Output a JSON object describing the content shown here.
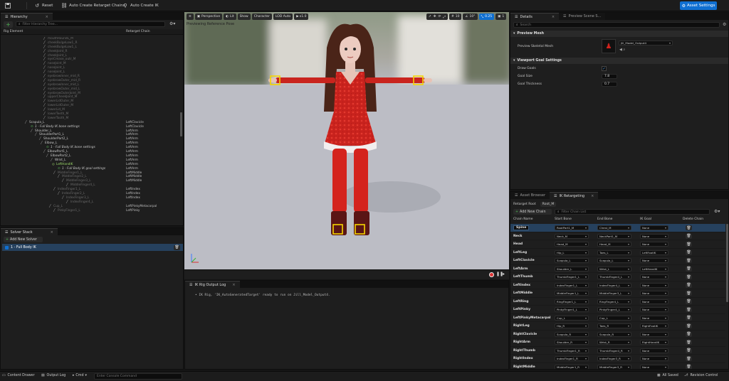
{
  "toolbar": {
    "save_icon": "save-icon",
    "reset": "Reset",
    "auto_create_chains": "Auto Create Retarget Chains",
    "auto_create_ik": "Auto Create IK",
    "asset_settings": "Asset Settings"
  },
  "hierarchy": {
    "tab": "Hierarchy",
    "filter_placeholder": "Filter Hierarchy Tree...",
    "col_element": "Rig Element",
    "col_chain": "Retarget Chain",
    "rows": [
      {
        "name": "mouthRoundL_M",
        "chain": "",
        "indent": 66,
        "dim": true
      },
      {
        "name": "cheekBulgeLow1_R",
        "chain": "",
        "indent": 66,
        "dim": true
      },
      {
        "name": "cheekBulgeLow1_L",
        "chain": "",
        "indent": 66,
        "dim": true
      },
      {
        "name": "cheekJoint_R",
        "chain": "",
        "indent": 66,
        "dim": true
      },
      {
        "name": "cheekJoint_L",
        "chain": "",
        "indent": 66,
        "dim": true
      },
      {
        "name": "eyeCrease_outr_M",
        "chain": "",
        "indent": 66,
        "dim": true
      },
      {
        "name": "noseJoint_M",
        "chain": "",
        "indent": 66,
        "dim": true
      },
      {
        "name": "noseJoint_L",
        "chain": "",
        "indent": 66,
        "dim": true
      },
      {
        "name": "noseJoint_L",
        "chain": "",
        "indent": 66,
        "dim": true
      },
      {
        "name": "eyebrowInner_mid_R",
        "chain": "",
        "indent": 66,
        "dim": true
      },
      {
        "name": "eyebrowOuter_mid_R",
        "chain": "",
        "indent": 66,
        "dim": true
      },
      {
        "name": "eyebrowInner_mid_L",
        "chain": "",
        "indent": 66,
        "dim": true
      },
      {
        "name": "eyebrowOuter_mid_L",
        "chain": "",
        "indent": 66,
        "dim": true
      },
      {
        "name": "eyebrowOuterJoint_M",
        "chain": "",
        "indent": 66,
        "dim": true
      },
      {
        "name": "upperCheekJoint_M",
        "chain": "",
        "indent": 66,
        "dim": true
      },
      {
        "name": "lowerLidOuter_M",
        "chain": "",
        "indent": 66,
        "dim": true
      },
      {
        "name": "lowerLidOuter_M",
        "chain": "",
        "indent": 66,
        "dim": true
      },
      {
        "name": "lowerLid_M",
        "chain": "",
        "indent": 66,
        "dim": true
      },
      {
        "name": "lowerTeeth_M",
        "chain": "",
        "indent": 66,
        "dim": true
      },
      {
        "name": "lowerTooth_M",
        "chain": "",
        "indent": 66,
        "dim": true
      },
      {
        "name": "Scapula_L",
        "chain": "LeftClavicle",
        "indent": 40,
        "dim": false
      },
      {
        "name": "1 - Full Body IK bone settings",
        "chain": "LeftClavicle",
        "indent": 48,
        "dim": false,
        "italic": true
      },
      {
        "name": "Shoulder_L",
        "chain": "LeftArm",
        "indent": 48,
        "dim": false
      },
      {
        "name": "ShoulderPart1_L",
        "chain": "LeftArm",
        "indent": 54,
        "dim": false
      },
      {
        "name": "ShoulderPart2_L",
        "chain": "LeftArm",
        "indent": 60,
        "dim": false
      },
      {
        "name": "Elbow_L",
        "chain": "LeftArm",
        "indent": 62,
        "dim": false
      },
      {
        "name": "1 - Full Body IK bone settings",
        "chain": "LeftArm",
        "indent": 70,
        "dim": false,
        "italic": true
      },
      {
        "name": "ElbowPart1_L",
        "chain": "LeftArm",
        "indent": 66,
        "dim": false
      },
      {
        "name": "ElbowPart2_L",
        "chain": "LeftArm",
        "indent": 70,
        "dim": false
      },
      {
        "name": "Wrist_L",
        "chain": "LeftArm",
        "indent": 76,
        "dim": false
      },
      {
        "name": "LeftHandIK",
        "chain": "LeftArm",
        "indent": 78,
        "dim": false,
        "goal": true
      },
      {
        "name": "1 - Full Body IK goal settings",
        "chain": "LeftArm",
        "indent": 86,
        "dim": false,
        "italic": true
      },
      {
        "name": "MiddleFinger1_L",
        "chain": "LeftMiddle",
        "indent": 80,
        "dim": true
      },
      {
        "name": "MiddleFinger2_L",
        "chain": "LeftMiddle",
        "indent": 86,
        "dim": true
      },
      {
        "name": "MiddleFinger3_L",
        "chain": "LeftMiddle",
        "indent": 92,
        "dim": true
      },
      {
        "name": "MiddleFinger4_L",
        "chain": "",
        "indent": 98,
        "dim": true
      },
      {
        "name": "IndexFinger1_L",
        "chain": "LeftIndex",
        "indent": 80,
        "dim": true
      },
      {
        "name": "IndexFinger2_L",
        "chain": "LeftIndex",
        "indent": 86,
        "dim": true
      },
      {
        "name": "IndexFinger3_L",
        "chain": "LeftIndex",
        "indent": 92,
        "dim": true
      },
      {
        "name": "IndexFinger4_L",
        "chain": "",
        "indent": 98,
        "dim": true
      },
      {
        "name": "Cup_L",
        "chain": "LeftPinkyMetacarpal",
        "indent": 74,
        "dim": true
      },
      {
        "name": "PinkyFinger1_L",
        "chain": "LeftPinky",
        "indent": 80,
        "dim": true
      }
    ]
  },
  "solver": {
    "tab": "Solver Stack",
    "add_new": "Add New Solver",
    "item": "1 - Full Body IK"
  },
  "viewport": {
    "perspective": "Perspective",
    "lit": "Lit",
    "show": "Show",
    "character": "Character",
    "lod": "LOD Auto",
    "speed": "x1.0",
    "overlay": "Previewing Reference Pose",
    "grid": "10",
    "angle": "10°",
    "scale": "0.25",
    "cam": "1"
  },
  "output_log": {
    "tab": "IK Rig Output Log",
    "line": "• IK Rig, 'IK_AutoGeneratedTarget' ready to run on Jill_Model_Output4."
  },
  "details": {
    "tab": "Details",
    "tab2": "Preview Scene S...",
    "search_placeholder": "Search",
    "section_mesh": "Preview Mesh",
    "preview_mesh_label": "Preview Skeletal Mesh",
    "preview_mesh_value": "Jill_Model_Output4",
    "section_goal": "Viewport Goal Settings",
    "draw_goals_label": "Draw Goals",
    "goal_size_label": "Goal Size",
    "goal_size_value": "7.8",
    "goal_thickness_label": "Goal Thickness",
    "goal_thickness_value": "0.7"
  },
  "retarget": {
    "tab_asset_browser": "Asset Browser",
    "tab_ik": "IK Retargeting",
    "root_label": "Retarget Root",
    "root_value": "Root_M",
    "add_chain": "Add New Chain",
    "filter_placeholder": "Filter Chain List",
    "cols": [
      "Chain Name",
      "Start Bone",
      "End Bone",
      "IK Goal",
      "Delete Chain"
    ],
    "rows": [
      {
        "chain": "Spine",
        "start": "RootPart1_M",
        "end": "Chest_M",
        "goal": "None"
      },
      {
        "chain": "Neck",
        "start": "Neck_M",
        "end": "NeckPart1_M",
        "goal": "None"
      },
      {
        "chain": "Head",
        "start": "Head_M",
        "end": "Head_M",
        "goal": "None"
      },
      {
        "chain": "LeftLeg",
        "start": "Hip_L",
        "end": "Toes_L",
        "goal": "LeftFootIK"
      },
      {
        "chain": "LeftClavicle",
        "start": "Scapula_L",
        "end": "Scapula_L",
        "goal": "None"
      },
      {
        "chain": "LeftArm",
        "start": "Shoulder_L",
        "end": "Wrist_L",
        "goal": "LeftHandIK"
      },
      {
        "chain": "LeftThumb",
        "start": "ThumbFinger1_L",
        "end": "ThumbFinger4_L",
        "goal": "None"
      },
      {
        "chain": "LeftIndex",
        "start": "IndexFinger1_L",
        "end": "IndexFinger4_L",
        "goal": "None"
      },
      {
        "chain": "LeftMiddle",
        "start": "MiddleFinger1_L",
        "end": "MiddleFinger3_L",
        "goal": "None"
      },
      {
        "chain": "LeftRing",
        "start": "RingFinger1_L",
        "end": "RingFinger4_L",
        "goal": "None"
      },
      {
        "chain": "LeftPinky",
        "start": "PinkyFinger1_L",
        "end": "PinkyFinger4_L",
        "goal": "None"
      },
      {
        "chain": "LeftPinkyMetacarpal",
        "start": "Cup_L",
        "end": "Cup_L",
        "goal": "None"
      },
      {
        "chain": "RightLeg",
        "start": "Hip_R",
        "end": "Toes_R",
        "goal": "RightFootIK"
      },
      {
        "chain": "RightClavicle",
        "start": "Scapula_R",
        "end": "Scapula_R",
        "goal": "None"
      },
      {
        "chain": "RightArm",
        "start": "Shoulder_R",
        "end": "Wrist_R",
        "goal": "RightHandIK"
      },
      {
        "chain": "RightThumb",
        "start": "ThumbFinger1_R",
        "end": "ThumbFinger4_R",
        "goal": "None"
      },
      {
        "chain": "RightIndex",
        "start": "IndexFinger1_R",
        "end": "IndexFinger3_R",
        "goal": "None"
      },
      {
        "chain": "RightMiddle",
        "start": "MiddleFinger1_R",
        "end": "MiddleFinger3_R",
        "goal": "None"
      }
    ]
  },
  "statusbar": {
    "content_drawer": "Content Drawer",
    "output_log": "Output Log",
    "cmd": "Cmd",
    "console_placeholder": "Enter Console Command",
    "all_saved": "All Saved",
    "revision_control": "Revision Control"
  },
  "colors": {
    "accent_blue": "#0f6fd1",
    "selected_row": "#26415e",
    "goal_yellow": "#f5d400"
  }
}
